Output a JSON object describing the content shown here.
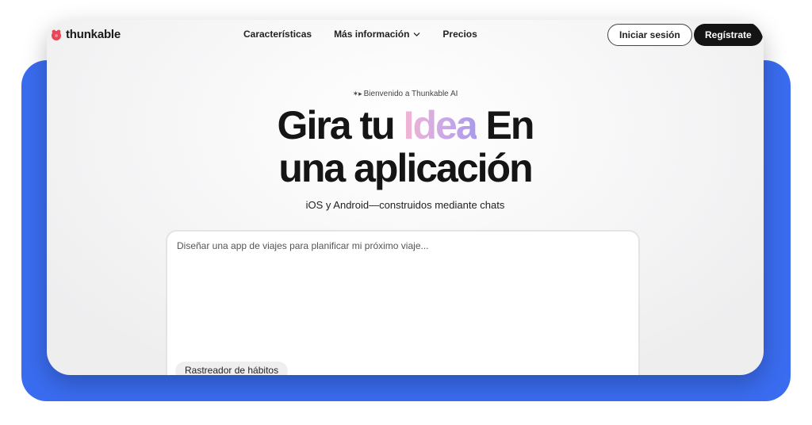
{
  "brand": {
    "name": "thunkable",
    "accent": "#e8475a"
  },
  "nav": {
    "links": [
      {
        "label": "Características"
      },
      {
        "label": "Más información"
      },
      {
        "label": "Precios"
      }
    ],
    "login_label": "Iniciar sesión",
    "register_label": "Regístrate"
  },
  "hero": {
    "welcome_icon": "sparkle-arrow-icon",
    "welcome": "Bienvenido a Thunkable AI",
    "headline_part1": "Gira tu ",
    "headline_highlight": "Idea",
    "headline_part2": " En",
    "headline_line2": "una aplicación",
    "subline": "iOS y Android—construidos mediante chats"
  },
  "prompt": {
    "placeholder": "Diseñar una app de viajes para planificar mi próximo viaje...",
    "value": "",
    "suggestion_chip": "Rastreador de hábitos"
  },
  "colors": {
    "frame_blue": "#3a6cf0",
    "dark_button": "#141414",
    "highlight_gradient": [
      "#f3b6d2",
      "#c9a6e8",
      "#a99ae8"
    ]
  }
}
